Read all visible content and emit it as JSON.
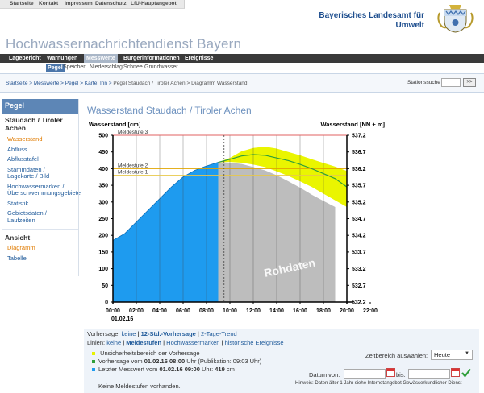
{
  "topnav": [
    "Startseite",
    "Kontakt",
    "Impressum",
    "Datenschutz",
    "LfU-Hauptangebot"
  ],
  "agency": {
    "line1": "Bayerisches Landesamt für",
    "line2": "Umwelt"
  },
  "site_title": "Hochwassernachrichtendienst Bayern",
  "mainnav": [
    "Lagebericht",
    "Warnungen",
    "Messwerte",
    "Bürgerinformationen",
    "Ereignisse"
  ],
  "subnav": [
    "Pegel",
    "Speicher",
    "Niederschlag",
    "Schnee",
    "Grundwasser"
  ],
  "breadcrumb": {
    "items": [
      "Startseite",
      "Messwerte",
      "Pegel",
      "Karte: Inn"
    ],
    "current": "Pegel Staudach / Tiroler Achen > Diagramm Wasserstand",
    "sep": ">"
  },
  "station_search": {
    "label": "Stationssuche",
    "button": ">>"
  },
  "sidebar": {
    "header": "Pegel",
    "station": "Staudach / Tiroler Achen",
    "items": [
      "Wasserstand",
      "Abfluss",
      "Abflusstafel",
      "Stammdaten / Lagekarte / Bild",
      "Hochwassermarken / Überschwemmungsgebiete",
      "Statistik",
      "Gebietsdaten / Laufzeiten"
    ],
    "section": "Ansicht",
    "view_items": [
      "Diagramm",
      "Tabelle"
    ]
  },
  "chart_title": "Wasserstand Staudach / Tiroler Achen",
  "chart_data": {
    "type": "line",
    "y_left_label": "Wasserstand [cm]",
    "y_right_label": "Wasserstand [NN + m]",
    "ylim": [
      0,
      500
    ],
    "y_ticks": [
      0,
      50,
      100,
      150,
      200,
      250,
      300,
      350,
      400,
      450,
      500
    ],
    "y_right_ticks": [
      "532.2",
      "532.7",
      "533.2",
      "533.7",
      "534.2",
      "534.7",
      "535.2",
      "535.7",
      "536.2",
      "536.7",
      "537.2"
    ],
    "x_ticks": [
      "00:00",
      "02:00",
      "04:00",
      "06:00",
      "08:00",
      "10:00",
      "12:00",
      "14:00",
      "16:00",
      "18:00",
      "20:00",
      "22:00"
    ],
    "date_label": "01.02.16",
    "thresholds": [
      {
        "name": "Meldestufe 3",
        "value": 500,
        "color": "#e06060"
      },
      {
        "name": "Meldestufe 2",
        "value": 400,
        "color": "#e0a400"
      },
      {
        "name": "Meldestufe 1",
        "value": 380,
        "color": "#e8c84a"
      }
    ],
    "measured": {
      "x": [
        0,
        1,
        2,
        3,
        4,
        5,
        6,
        7,
        8,
        9
      ],
      "y": [
        185,
        205,
        240,
        275,
        310,
        345,
        375,
        395,
        408,
        419
      ]
    },
    "raw_label": "Rohdaten",
    "raw": {
      "x": [
        9,
        10,
        11,
        12,
        13,
        14,
        15,
        16,
        17,
        18,
        19
      ],
      "y": [
        419,
        418,
        414,
        405,
        395,
        380,
        362,
        343,
        322,
        303,
        285
      ]
    },
    "forecast": {
      "x": [
        9,
        10,
        11,
        12,
        13,
        14,
        15,
        16,
        17,
        18,
        19,
        20
      ],
      "y": [
        419,
        428,
        438,
        442,
        440,
        432,
        424,
        413,
        400,
        385,
        370,
        345
      ]
    },
    "uncertainty_upper": {
      "x": [
        9,
        10,
        11,
        12,
        13,
        14,
        15,
        16,
        17,
        18,
        19,
        20
      ],
      "y": [
        419,
        432,
        452,
        462,
        466,
        460,
        450,
        440,
        428,
        417,
        406,
        393
      ]
    },
    "uncertainty_lower": {
      "x": [
        9,
        10,
        11,
        12,
        13,
        14,
        15,
        16,
        17,
        18,
        19,
        20
      ],
      "y": [
        419,
        420,
        418,
        412,
        405,
        392,
        378,
        362,
        345,
        325,
        305,
        285
      ]
    },
    "colors": {
      "measured": "#1e9bef",
      "raw": "#bdbdbd",
      "forecast_band": "#eaf500",
      "forecast_line": "#2f9e3a"
    }
  },
  "info": {
    "forecast_label": "Vorhersage:",
    "forecast_none": "keine",
    "forecast_12": "12-Std.-Vorhersage",
    "forecast_2d": "2-Tage-Trend",
    "lines_label": "Linien:",
    "lines_none": "keine",
    "lines_meld": "Meldestufen",
    "lines_marks": "Hochwassermarken",
    "lines_hist": "historische Ereignisse",
    "legend": [
      {
        "text": "Unsicherheitsbereich der Vorhersage",
        "color": "#e8f200"
      },
      {
        "text_pre": "Vorhersage vom ",
        "bold": "01.02.16 08:00",
        "text_post": " Uhr (Publikation: 09:03 Uhr)",
        "color": "#2f9e3a"
      },
      {
        "text_pre": "Letzter Messwert vom ",
        "bold": "01.02.16 09:00",
        "text_mid": " Uhr: ",
        "bold2": "419",
        "text_post": " cm",
        "color": "#1e9bef"
      }
    ],
    "no_levels": "Keine Meldestufen vorhanden.",
    "range_label": "Zeitbereich auswählen:",
    "range_value": "Heute",
    "date_from": "Datum von:",
    "date_to": "bis:",
    "hint": "Hinweis: Daten älter 1 Jahr siehe Internetangebot Gewässerkundlicher Dienst"
  }
}
